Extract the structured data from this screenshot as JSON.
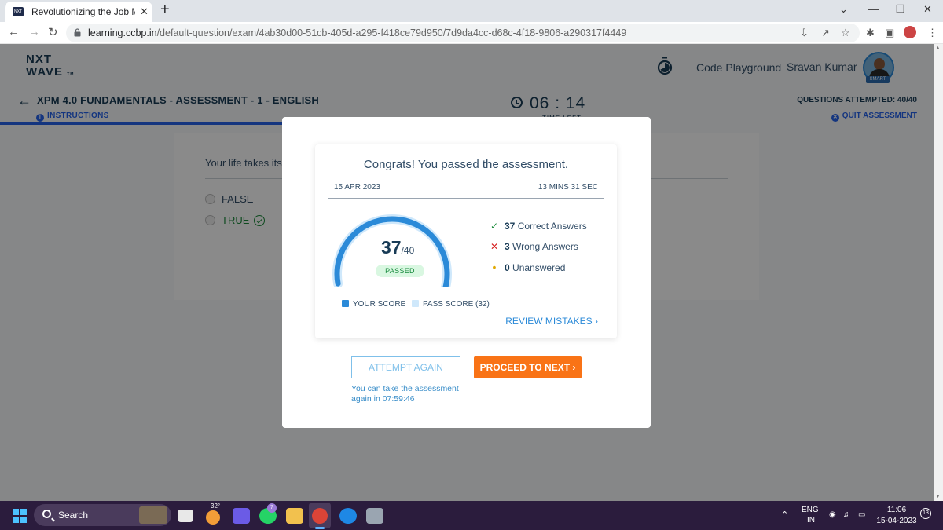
{
  "browser": {
    "tab_title": "Revolutionizing the Job Market |",
    "tab_close": "✕",
    "new_tab": "+",
    "url_host": "learning.ccbp.in",
    "url_path": "/default-question/exam/4ab30d00-51cb-405d-a295-f418ce79d950/7d9da4cc-d68c-4f18-9806-a290317f4449"
  },
  "header": {
    "logo_line1": "NXT",
    "logo_line2": "WAVE",
    "logo_tm": "TM",
    "code_playground": "Code Playground",
    "username": "Sravan Kumar",
    "avatar_badge": "SMART"
  },
  "exam": {
    "title": "XPM 4.0 FUNDAMENTALS - ASSESSMENT - 1 - ENGLISH",
    "instructions": "INSTRUCTIONS",
    "timer": "06 : 14",
    "time_left_label": "TIME LEFT",
    "questions_attempted": "QUESTIONS ATTEMPTED: 40/40",
    "quit": "QUIT ASSESSMENT"
  },
  "question": {
    "text": "Your life takes its",
    "options": [
      {
        "label": "FALSE",
        "correct": false
      },
      {
        "label": "TRUE",
        "correct": true
      }
    ]
  },
  "result": {
    "heading": "Congrats! You passed the assessment.",
    "date": "15 APR 2023",
    "duration": "13 MINS 31 SEC",
    "score": 37,
    "score_text": "37",
    "total_text": "/40",
    "total": 40,
    "pass_score": 32,
    "status": "PASSED",
    "correct_count": "37",
    "correct_label": "Correct Answers",
    "wrong_count": "3",
    "wrong_label": "Wrong Answers",
    "unanswered_count": "0",
    "unanswered_label": "Unanswered",
    "legend_your_score": "YOUR SCORE",
    "legend_pass_score": "PASS SCORE (32)",
    "review_mistakes": "REVIEW MISTAKES",
    "attempt_again": "ATTEMPT AGAIN",
    "proceed": "PROCEED TO NEXT",
    "retake_note": "You can take the assessment again in 07:59:46"
  },
  "colors": {
    "score_arc": "#2b8ad8",
    "pass_arc": "#cfe8fb",
    "proceed": "#f97316",
    "passed_text": "#168a3c",
    "overlay": "rgba(0,0,0,0.46)"
  },
  "taskbar": {
    "search": "Search",
    "weather_temp": "32°",
    "whatsapp_badge": "7",
    "lang_line1": "ENG",
    "lang_line2": "IN",
    "time": "11:06",
    "date": "15-04-2023",
    "notifications": "13"
  }
}
